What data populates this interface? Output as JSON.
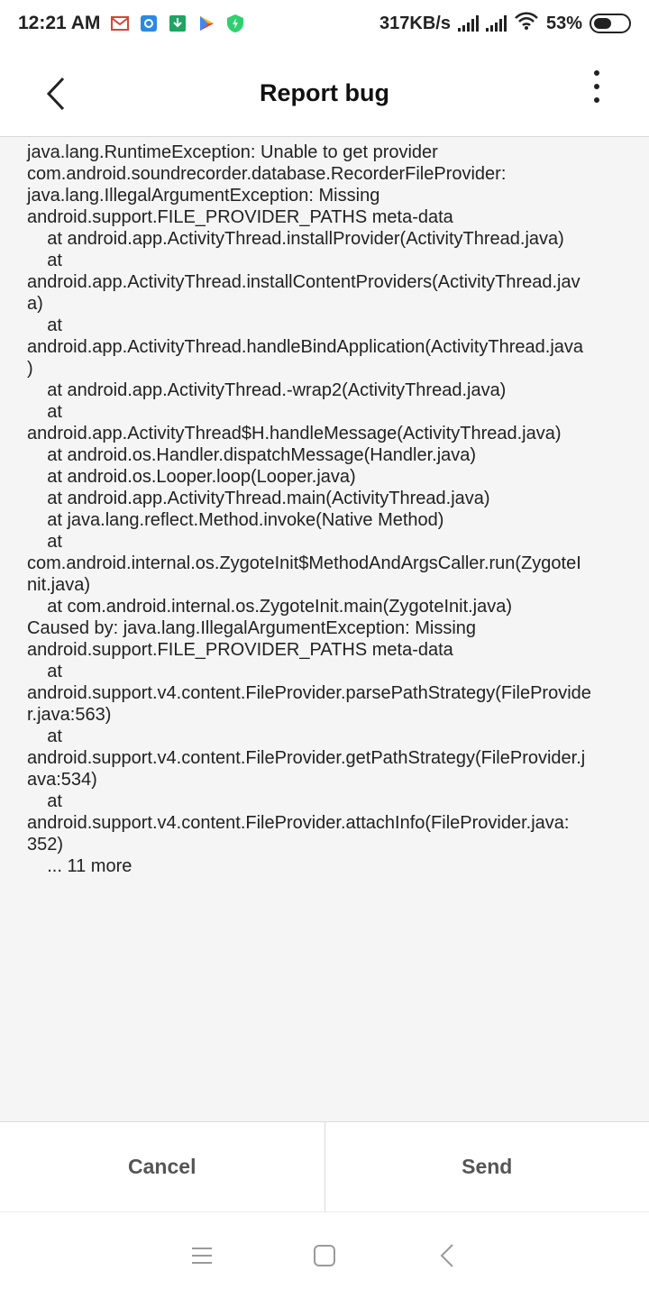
{
  "status_bar": {
    "time": "12:21 AM",
    "notification_icons": [
      "gmail-icon",
      "app-store-icon",
      "download-icon",
      "play-store-icon",
      "shield-icon"
    ],
    "network_speed": "317KB/s",
    "battery_percent": "53%",
    "battery_level": 0.53
  },
  "header": {
    "title": "Report bug"
  },
  "log": {
    "text": "java.lang.RuntimeException: Unable to get provider\ncom.android.soundrecorder.database.RecorderFileProvider:\njava.lang.IllegalArgumentException: Missing\nandroid.support.FILE_PROVIDER_PATHS meta-data\n    at android.app.ActivityThread.installProvider(ActivityThread.java)\n    at\nandroid.app.ActivityThread.installContentProviders(ActivityThread.jav\na)\n    at\nandroid.app.ActivityThread.handleBindApplication(ActivityThread.java\n)\n    at android.app.ActivityThread.-wrap2(ActivityThread.java)\n    at\nandroid.app.ActivityThread$H.handleMessage(ActivityThread.java)\n    at android.os.Handler.dispatchMessage(Handler.java)\n    at android.os.Looper.loop(Looper.java)\n    at android.app.ActivityThread.main(ActivityThread.java)\n    at java.lang.reflect.Method.invoke(Native Method)\n    at\ncom.android.internal.os.ZygoteInit$MethodAndArgsCaller.run(ZygoteI\nnit.java)\n    at com.android.internal.os.ZygoteInit.main(ZygoteInit.java)\nCaused by: java.lang.IllegalArgumentException: Missing\nandroid.support.FILE_PROVIDER_PATHS meta-data\n    at\nandroid.support.v4.content.FileProvider.parsePathStrategy(FileProvide\nr.java:563)\n    at\nandroid.support.v4.content.FileProvider.getPathStrategy(FileProvider.j\nava:534)\n    at\nandroid.support.v4.content.FileProvider.attachInfo(FileProvider.java:\n352)\n    ... 11 more"
  },
  "actions": {
    "cancel_label": "Cancel",
    "send_label": "Send"
  },
  "nav_bar": {
    "items": [
      "menu-icon",
      "home-icon",
      "back-icon"
    ]
  },
  "colors": {
    "background": "#f5f5f5",
    "surface": "#ffffff",
    "text": "#222222",
    "button_text": "#555555",
    "shield_green": "#2fcf6f",
    "gmail_red": "#d44638"
  }
}
